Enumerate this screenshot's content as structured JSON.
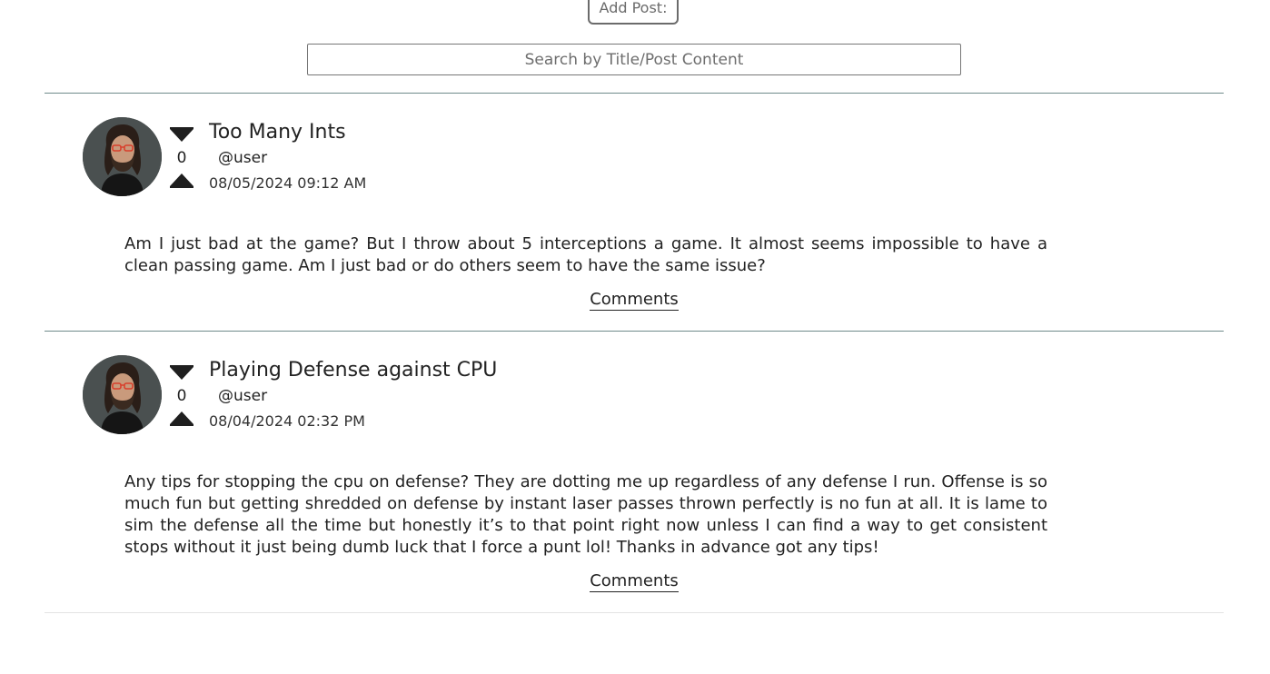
{
  "header": {
    "add_post_label": "Add Post:",
    "search_placeholder": "Search by Title/Post Content"
  },
  "posts": [
    {
      "title": "Too Many Ints",
      "handle": "@user",
      "date": "08/05/2024 09:12 AM",
      "score": "0",
      "body": "Am I just bad at the game? But I throw about 5 interceptions a game. It almost seems impossible to have a clean passing game. Am I just bad or do others seem to have the same issue?",
      "comments_label": "Comments",
      "avatar_icon": "user-avatar"
    },
    {
      "title": "Playing Defense against CPU",
      "handle": "@user",
      "date": "08/04/2024 02:32 PM",
      "score": "0",
      "body": "Any tips for stopping the cpu on defense? They are dotting me up regardless of any defense I run. Offense is so much fun but getting shredded on defense by instant laser passes thrown perfectly is no fun at all. It is lame to sim the defense all the time but honestly it’s to that point right now unless I can find a way to get consistent stops without it just being dumb luck that I force a punt lol! Thanks in advance got any tips!",
      "comments_label": "Comments",
      "avatar_icon": "user-avatar"
    }
  ],
  "icons": {
    "upvote": "caret-up-icon",
    "downvote": "caret-down-icon"
  }
}
